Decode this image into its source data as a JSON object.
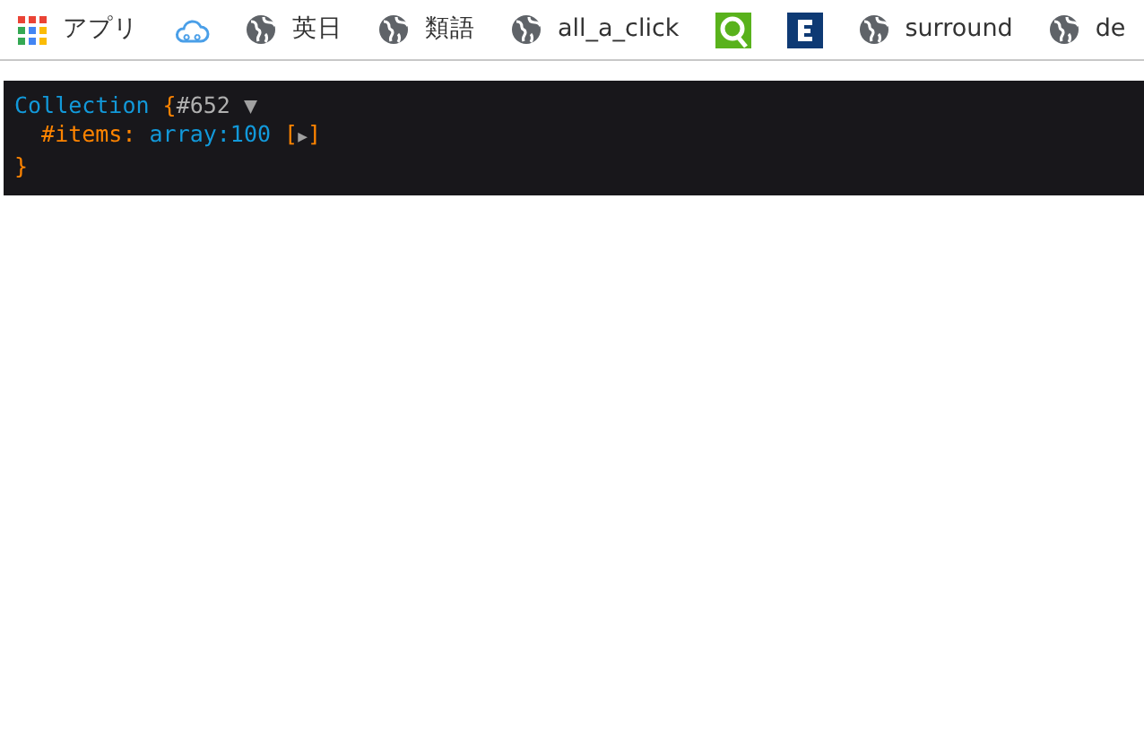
{
  "bookmarks": [
    {
      "kind": "apps",
      "label": "アプリ"
    },
    {
      "kind": "cloud"
    },
    {
      "kind": "globe",
      "label": "英日"
    },
    {
      "kind": "globe",
      "label": "類語"
    },
    {
      "kind": "globe",
      "label": "all_a_click"
    },
    {
      "kind": "q"
    },
    {
      "kind": "e"
    },
    {
      "kind": "globe",
      "label": "surround"
    },
    {
      "kind": "globe",
      "label": "de"
    }
  ],
  "dump": {
    "class_name": "Collection",
    "open_brace": "{",
    "object_id": "#652",
    "toggle": "▼",
    "properties": [
      {
        "name": "#items",
        "colon": ":",
        "value": "array:100",
        "expand": {
          "open": "[",
          "arrow": "▶",
          "close": "]"
        }
      }
    ],
    "close_brace": "}"
  }
}
